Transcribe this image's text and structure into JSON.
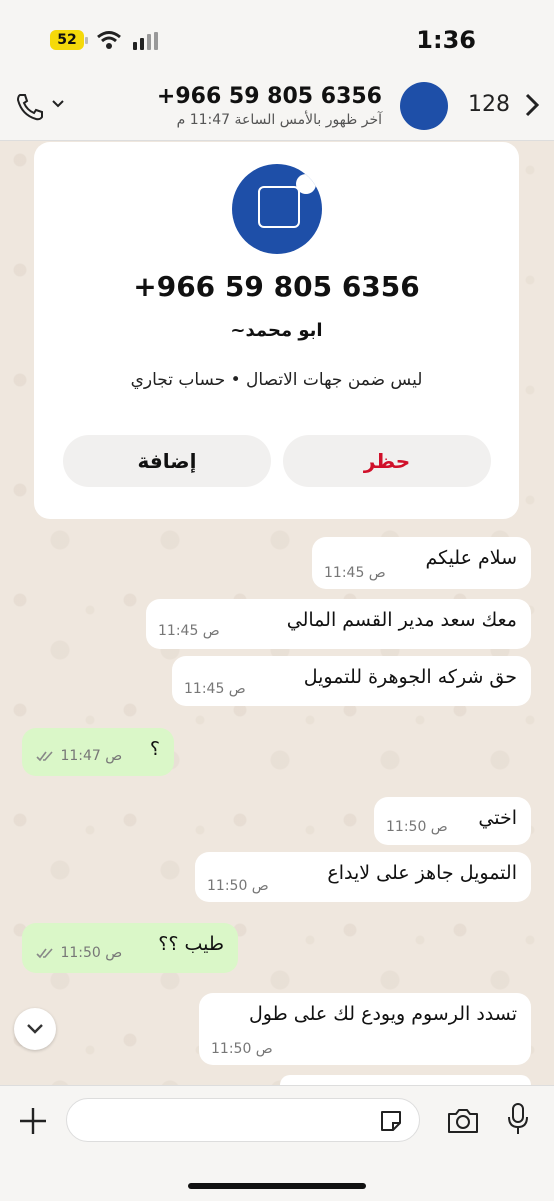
{
  "status_bar": {
    "time": "1:36",
    "battery": "52"
  },
  "header": {
    "title": "+966 59 805 6356",
    "subtitle": "آخر ظهور بالأمس الساعة 11:47 م",
    "unread_count": "128"
  },
  "contact_card": {
    "phone_number": "+966 59 805 6356",
    "display_name": "~ابو محمد",
    "info": "ليس ضمن جهات الاتصال • حساب تجاري",
    "block_label": "حظر",
    "add_label": "إضافة"
  },
  "messages": [
    {
      "dir": "in",
      "text": "سلام عليكم",
      "time": "11:45 ص"
    },
    {
      "dir": "in",
      "text": "معك سعد مدير القسم المالي",
      "time": "11:45 ص"
    },
    {
      "dir": "in",
      "text": "حق شركه الجوهرة للتمويل",
      "time": "11:45 ص"
    },
    {
      "dir": "out",
      "text": "؟",
      "time": "11:47 ص"
    },
    {
      "dir": "in",
      "text": "اختي",
      "time": "11:50 ص"
    },
    {
      "dir": "in",
      "text": "التمويل جاهز على لايداع",
      "time": "11:50 ص"
    },
    {
      "dir": "out",
      "text": "طيب ؟؟",
      "time": "11:50 ص"
    },
    {
      "dir": "in",
      "text": "تسدد الرسوم ويودع لك على طول",
      "time": "11:50 ص"
    }
  ],
  "colors": {
    "block": "#d0102a",
    "outgoing": "#daf7c8",
    "incoming": "#ffffff",
    "avatar": "#1e4fa8"
  }
}
